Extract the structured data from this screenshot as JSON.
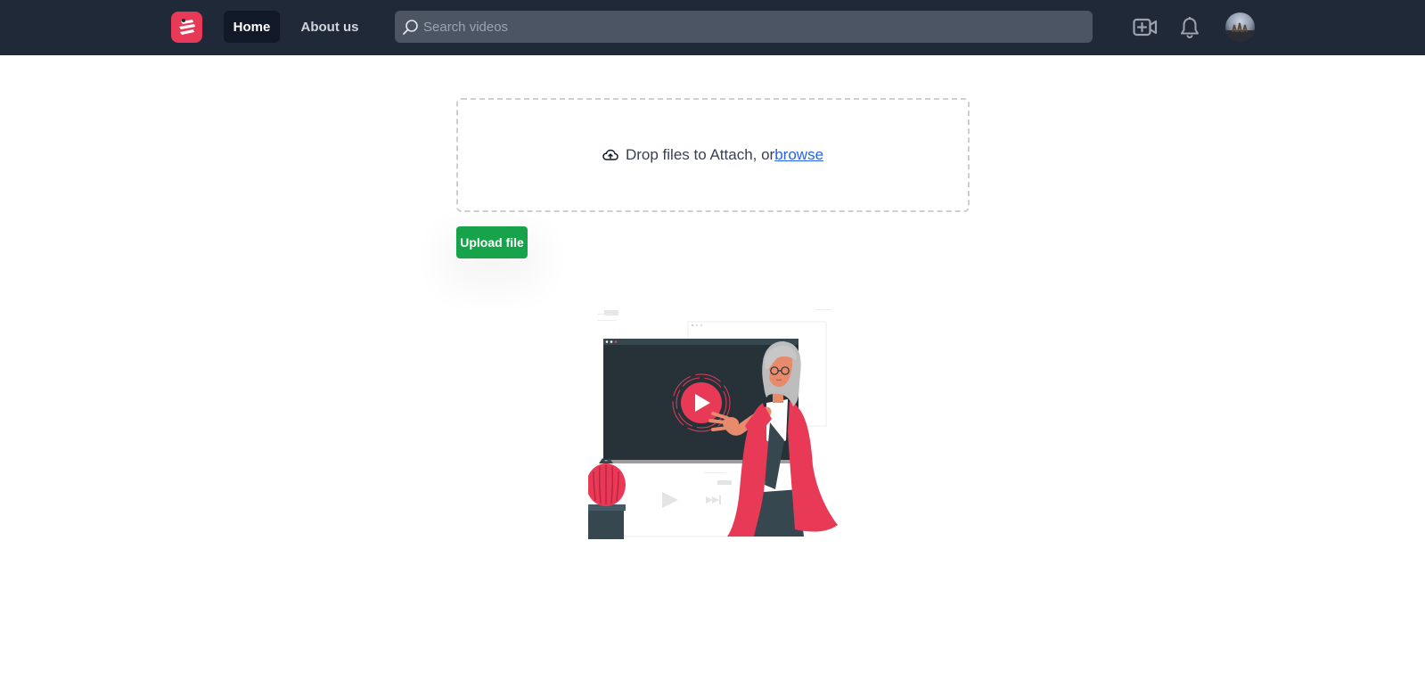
{
  "nav": {
    "home_label": "Home",
    "about_label": "About us",
    "search_placeholder": "Search videos",
    "icons": [
      "search-icon",
      "add-video-icon",
      "bell-icon"
    ]
  },
  "upload": {
    "drop_text": "Drop files to Attach, or",
    "browse_label": "browse",
    "upload_button_label": "Upload file"
  },
  "colors": {
    "navbar": "#1f2937",
    "brand": "#e83a57",
    "upload_button": "#16a34a",
    "link": "#2563eb"
  }
}
